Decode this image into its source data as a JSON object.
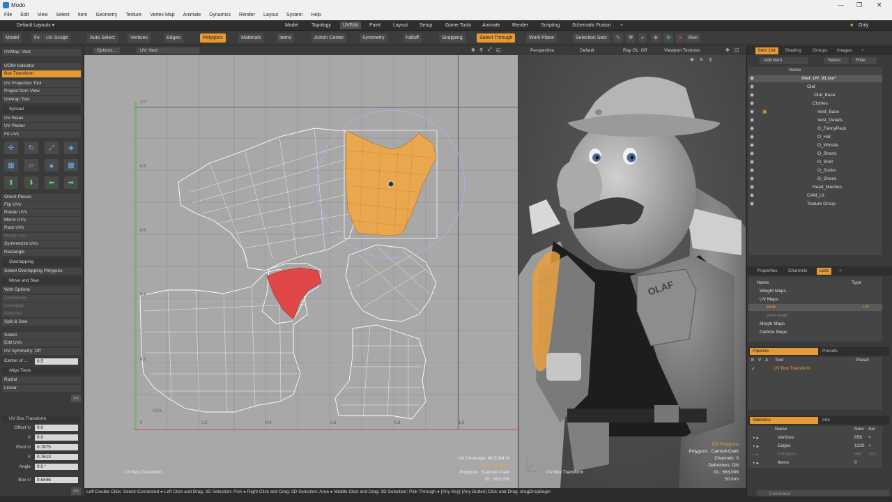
{
  "title": "Modo",
  "window_controls": [
    "—",
    "❐",
    "✕"
  ],
  "menu": [
    "File",
    "Edit",
    "View",
    "Select",
    "Item",
    "Geometry",
    "Texture",
    "Vertex Map",
    "Animate",
    "Dynamics",
    "Render",
    "Layout",
    "System",
    "Help"
  ],
  "layout_selector": "Default Layouts ▾",
  "tabs": [
    "Model",
    "Topology",
    "UVEdit",
    "Paint",
    "Layout",
    "Setup",
    "Game Tools",
    "Animate",
    "Render",
    "Scripting",
    "Schematic Fusion",
    "+"
  ],
  "active_tab": "UVEdit",
  "only_label": "Only",
  "toolbar": {
    "model": "Model",
    "fx": "Fx",
    "uv_sculpt": "UV Sculpt",
    "auto_select": "Auto Select",
    "vertices": "Vertices",
    "edges": "Edges",
    "polygons": "Polygons",
    "materials": "Materials",
    "items": "Items",
    "action_center": "Action Center",
    "symmetry": "Symmetry",
    "falloff": "Falloff",
    "snapping": "Snapping",
    "select_through": "Select Through",
    "work_plane": "Work Plane",
    "selection_sets": "Selection Sets",
    "run": "Run"
  },
  "left": {
    "uvmap": "UVMap: Vest",
    "udim": "UDIM Indicator",
    "box_transform": "Box Transform",
    "uv_projection": "UV Projection Tool",
    "project_view": "Project from View",
    "unwrap": "Unwrap Tool",
    "spread": "Spread",
    "uv_relax": "UV Relax",
    "uv_peeler": "UV Peeler",
    "fit_uvs": "Fit UVs",
    "orient": "Orient Pieces",
    "flip": "Flip UVs",
    "rotate": "Rotate UVs",
    "mirror": "Mirror UVs",
    "pack": "Pack UVs",
    "merge": "Merge UVs",
    "symmetrize": "Symmetrize UVs",
    "rectangle": "Rectangle",
    "overlapping": "Overlapping",
    "select_overlap": "Select Overlapping Polygons",
    "move_sew": "Move and Sew",
    "with_options": "With Options",
    "unselected": "Unselected",
    "averaged": "Averaged",
    "selected": "Selected",
    "split_sew": "Split & Sew",
    "select": "Select",
    "edit_uvs": "Edit UVs",
    "uv_symmetry": "UV Symmetry: Off",
    "center_of": "Center of ...",
    "center_val": "0.5",
    "align": "Align Tools",
    "radial": "Radial",
    "linear": "Linear",
    "more": ">>",
    "box_panel": "UV Box Transform",
    "props": [
      {
        "label": "Offset U",
        "value": "0.0"
      },
      {
        "label": "V",
        "value": "0.0"
      },
      {
        "label": "Pivot U",
        "value": "0.7875"
      },
      {
        "label": "V",
        "value": "0.7613"
      },
      {
        "label": "Angle",
        "value": "0.0 °"
      },
      {
        "label": "Box U",
        "value": "0.6446"
      }
    ]
  },
  "uv": {
    "options": "Options...",
    "uvname": "UV: Vest",
    "ticks_y": [
      "1.0",
      "0.8",
      "0.6",
      "0.4",
      "0.2"
    ],
    "ticks_x": [
      "0",
      "0.2",
      "0.4",
      "0.6",
      "0.8",
      "1.0"
    ],
    "udim": "1001",
    "tool_label": "UV Box Transform",
    "coverage": "UV Coverage: 49.3164 %",
    "polys": "100 Polygons",
    "cc": "Polygons : Catmull-Clark",
    "gl": "GL: 563,008"
  },
  "view3d": {
    "perspective": "Perspective",
    "default": "Default",
    "raygl": "Ray GL: Off",
    "viewport_tex": "Viewport Textures",
    "tool_label": "UV Box Transform",
    "stats": [
      "100 Polygons",
      "Polygons : Catmull-Clark",
      "Channels: 0",
      "Deformers: ON",
      "GL: 563,008",
      "50 mm"
    ],
    "badge": "OLAF"
  },
  "right": {
    "tabs": [
      "Item List",
      "Shading",
      "Groups",
      "Images",
      "+"
    ],
    "add_item": "Add Item",
    "select": "Select",
    "filter": "Filter",
    "name_col": "Name",
    "items": [
      "Olaf_UV_01.lxo*",
      "Olaf",
      "Olaf_Base",
      "Clothes",
      "Vest_Base",
      "Vest_Details",
      "O_FannyPack",
      "O_Hat",
      "O_Whistle",
      "O_Shorts",
      "O_Shirt",
      "O_Socks",
      "O_Shoes",
      "Head_Meshes",
      "CAM_Lit",
      "Texture Group"
    ],
    "tabs2": [
      "Properties",
      "Channels",
      "Lists",
      "+"
    ],
    "list_cols": [
      "Name",
      "Type"
    ],
    "lists": [
      "Weight Maps",
      "UV Maps",
      "Vest",
      "(new map)",
      "Morph Maps",
      "Particle Maps"
    ],
    "vest_type": "UV",
    "pipeline_tabs": [
      "Pipeline",
      "Presets"
    ],
    "pipe_cols": [
      "E",
      "V",
      "A",
      "Tool",
      "Preset"
    ],
    "pipe_item": "UV Box Transform",
    "stat_tabs": [
      "Statistics",
      "Info"
    ],
    "stat_cols": [
      "Name",
      "Num",
      "Sel"
    ],
    "stats": [
      {
        "name": "Vertices",
        "num": "658",
        "sel": "+"
      },
      {
        "name": "Edges",
        "num": "1320",
        "sel": "+"
      },
      {
        "name": "Polygons",
        "num": "660",
        "sel": "100"
      },
      {
        "name": "Items",
        "num": "0",
        "sel": ""
      }
    ],
    "command": "Command"
  },
  "status": "Left Double Click: Select Connected ● Left Click and Drag: 3D Selection: Pick ● Right Click and Drag: 3D Selection: Area ● Middle Click and Drag: 3D Selection: Pick Through ● [Any Key]-[Any Button] Click and Drag: dragDropBegin"
}
